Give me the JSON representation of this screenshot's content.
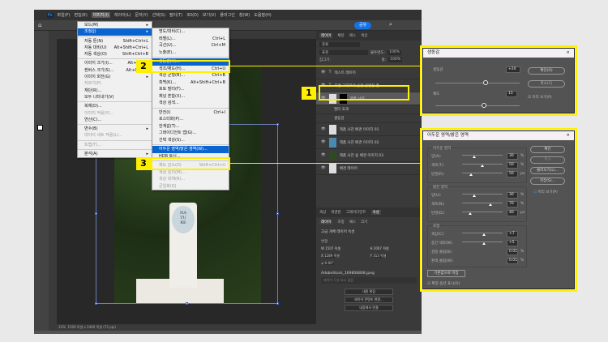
{
  "menubar": [
    "파일(F)",
    "편집(E)",
    "이미지(I)",
    "레이어(L)",
    "문자(Y)",
    "선택(S)",
    "필터(T)",
    "3D(D)",
    "보기(V)",
    "플러그인",
    "창(W)",
    "도움말(H)"
  ],
  "menubar_active": 2,
  "share_label": "공유",
  "image_menu": [
    {
      "label": "모드(M)",
      "sub": true
    },
    {
      "label": "조정(J)",
      "sub": true,
      "on": true
    },
    {
      "sep": true
    },
    {
      "label": "자동 톤(N)",
      "key": "Shift+Ctrl+L"
    },
    {
      "label": "자동 대비(U)",
      "key": "Alt+Shift+Ctrl+L"
    },
    {
      "label": "자동 색상(O)",
      "key": "Shift+Ctrl+B"
    },
    {
      "sep": true
    },
    {
      "label": "이미지 크기(I)...",
      "key": "Alt+Ctrl+I"
    },
    {
      "label": "캔버스 크기(S)...",
      "key": "Alt+Ctrl+C"
    },
    {
      "label": "이미지 회전(G)",
      "sub": true
    },
    {
      "label": "자르기(P)",
      "dis": true
    },
    {
      "label": "재단(R)..."
    },
    {
      "label": "모두 나타내기(V)"
    },
    {
      "sep": true
    },
    {
      "label": "복제(D)..."
    },
    {
      "label": "이미지 적용(Y)...",
      "dis": true
    },
    {
      "label": "연산(C)..."
    },
    {
      "sep": true
    },
    {
      "label": "변수(B)",
      "sub": true
    },
    {
      "label": "데이터 세트 적용(L)...",
      "dis": true
    },
    {
      "sep": true
    },
    {
      "label": "트랩(T)...",
      "dis": true
    },
    {
      "sep": true
    },
    {
      "label": "분석(A)",
      "sub": true
    }
  ],
  "adjust_menu": [
    {
      "label": "명도/대비(C)..."
    },
    {
      "label": "레벨(L)...",
      "key": "Ctrl+L"
    },
    {
      "label": "곡선(U)...",
      "key": "Ctrl+M"
    },
    {
      "label": "노출(E)..."
    },
    {
      "sep": true
    },
    {
      "label": "생동감(V)...",
      "on": true
    },
    {
      "label": "색조/채도(H)...",
      "key": "Ctrl+U"
    },
    {
      "label": "색상 균형(B)...",
      "key": "Ctrl+B"
    },
    {
      "label": "흑백(K)...",
      "key": "Alt+Shift+Ctrl+B"
    },
    {
      "label": "포토 필터(F)..."
    },
    {
      "label": "채널 혼합(X)..."
    },
    {
      "label": "색상 검색..."
    },
    {
      "sep": true
    },
    {
      "label": "반전(I)",
      "key": "Ctrl+I"
    },
    {
      "label": "포스터화(P)..."
    },
    {
      "label": "한계값(T)..."
    },
    {
      "label": "그레이디언트 맵(G)..."
    },
    {
      "label": "선택 색상(S)..."
    },
    {
      "sep": true
    },
    {
      "label": "어두운 영역/밝은 영역(W)...",
      "on": true
    },
    {
      "label": "HDR 토닝..."
    },
    {
      "sep": true
    },
    {
      "label": "채도 감소(D)",
      "key": "Shift+Ctrl+U",
      "dis": true
    },
    {
      "label": "색상 일치(M)...",
      "dis": true
    },
    {
      "label": "색상 대체(R)...",
      "dis": true
    },
    {
      "label": "균일화(Q)",
      "dis": true
    }
  ],
  "callouts": [
    "1",
    "2",
    "3"
  ],
  "product_label": "NA\nTU\nRE",
  "layers_panel": {
    "tabs": [
      "레이어",
      "채널",
      "패스",
      "색상"
    ],
    "filter": "종류",
    "blend": "표준",
    "opacity_label": "불투명도:",
    "opacity": "100%",
    "lock_label": "잠그기:",
    "fill_label": "칠:",
    "fill": "100%",
    "layers": [
      {
        "type": "text",
        "name": "텍스트 레이어"
      },
      {
        "type": "text",
        "name": "자연 그대로의 순한 클렌징 폼"
      },
      {
        "type": "image",
        "name": "제품 사진",
        "selected": true
      },
      {
        "type": "sub",
        "name": "필터 효과"
      },
      {
        "type": "sub",
        "name": "생동감"
      },
      {
        "type": "image",
        "name": "제품 사진 배경 이미지 01"
      },
      {
        "type": "image",
        "name": "제품 사진 배경 이미지 02"
      },
      {
        "type": "image",
        "name": "제품 사진 숲 배경 이미지 03"
      },
      {
        "type": "image",
        "name": "배경 레이어"
      }
    ]
  },
  "props_panel": {
    "tabs": [
      "색상",
      "색견본",
      "그레이디언트",
      "속성"
    ],
    "subtabs": [
      "레이어",
      "조정",
      "패스",
      "크기"
    ],
    "layer_type": "고급 개체 레이어 속성",
    "section": "변형",
    "w": "1507 픽셀",
    "h": "2007 픽셀",
    "x": "1289 픽셀",
    "y": "313 픽셀",
    "angle": "0.00°",
    "file": "AdobeStock_169808808.jpeg",
    "comp": "레이어 구성 요소 없음",
    "buttons": [
      "내용 편집",
      "레이어 콘텐츠 변환...",
      "내장에서 연결"
    ]
  },
  "status": {
    "zoom": "33%",
    "doc": "1500 픽셀 x 2400 픽셀 (72 ppi)"
  },
  "vibrance_dialog": {
    "title": "생동감",
    "vibrance_label": "생동감",
    "vibrance": "+20",
    "saturation_label": "채도",
    "saturation": "15",
    "vibrance_pos": 0.6,
    "saturation_pos": 0.58,
    "ok": "확인(O)",
    "cancel": "취소(C)",
    "preview": "미리 보기(P)"
  },
  "sh_dialog": {
    "title": "어두운 영역/밝은 영역",
    "shadows": {
      "title": "어두운 영역",
      "rows": [
        {
          "label": "양(A):",
          "value": "30",
          "unit": "%",
          "pos": 0.3
        },
        {
          "label": "색조(T):",
          "value": "50",
          "unit": "%",
          "pos": 0.5
        },
        {
          "label": "반경(R):",
          "value": "50",
          "unit": "px",
          "pos": 0.22
        }
      ]
    },
    "highlights": {
      "title": "밝은 영역",
      "rows": [
        {
          "label": "양(U):",
          "value": "30",
          "unit": "%",
          "pos": 0.3
        },
        {
          "label": "색조(N):",
          "value": "70",
          "unit": "%",
          "pos": 0.7
        },
        {
          "label": "반경(D):",
          "value": "40",
          "unit": "px",
          "pos": 0.2
        }
      ]
    },
    "adjust": {
      "title": "조정",
      "rows": [
        {
          "label": "색상(C):",
          "value": "+7",
          "unit": "",
          "pos": 0.53
        },
        {
          "label": "중간 색조(M):",
          "value": "+5",
          "unit": "",
          "pos": 0.53
        },
        {
          "label": "검정 클립(B):",
          "value": "0.01",
          "unit": "%"
        },
        {
          "label": "흰색 클립(W):",
          "value": "0.01",
          "unit": "%"
        }
      ]
    },
    "save_default": "기본값으로 저장",
    "more_options": "확장 옵션 표시(O)",
    "ok": "확인",
    "cancel": "취소",
    "load": "불러오기(L)...",
    "save": "저장(S)...",
    "preview": "미리 보기(P)"
  }
}
